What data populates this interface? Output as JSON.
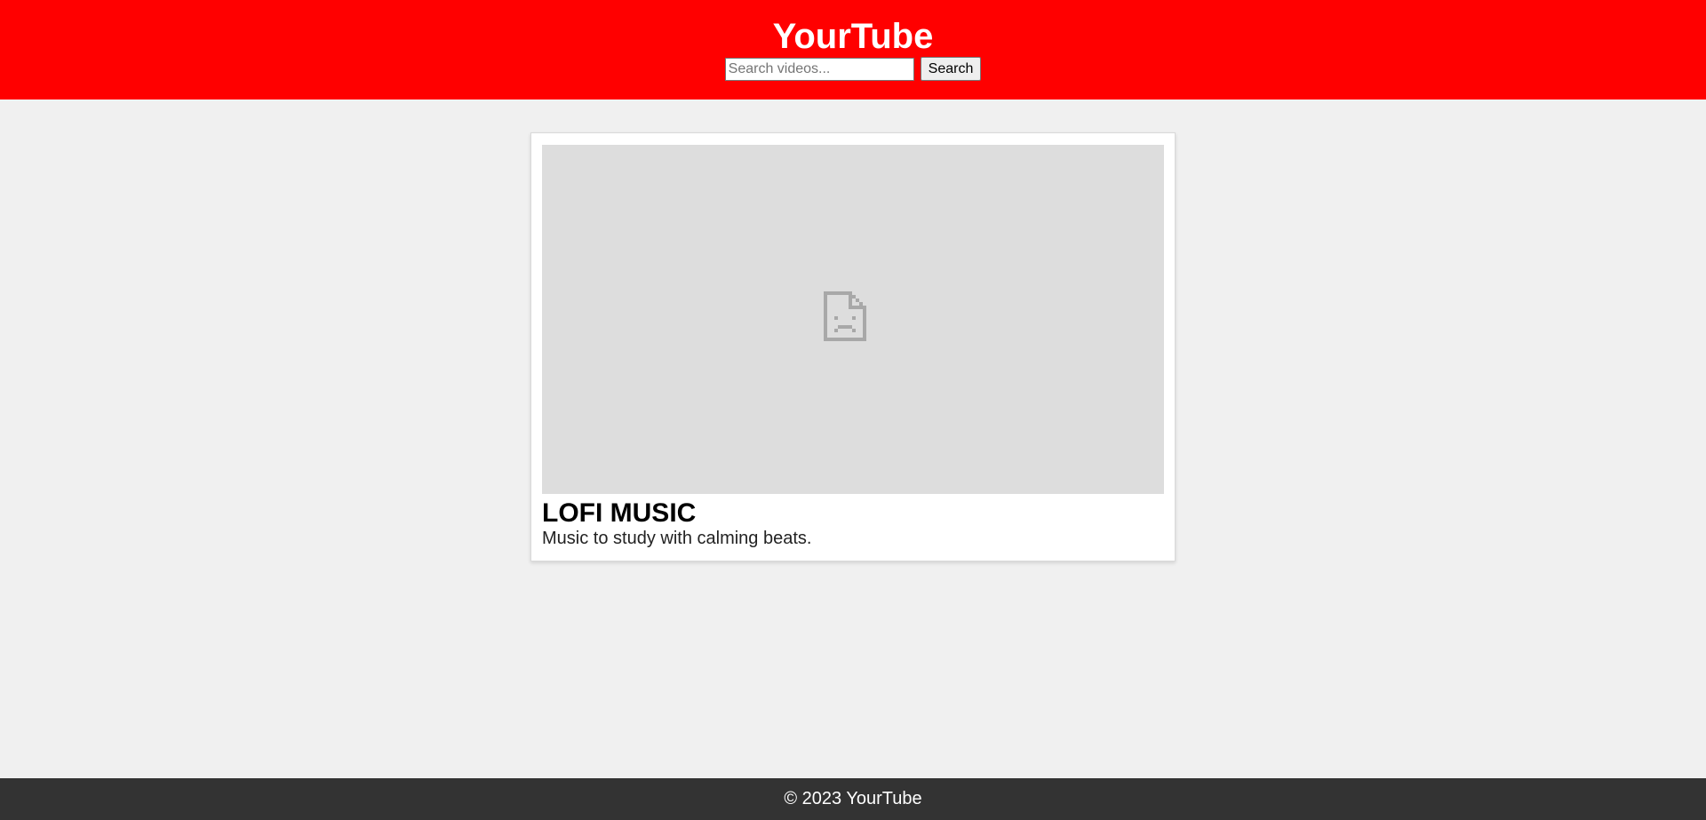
{
  "header": {
    "title": "YourTube",
    "search_placeholder": "Search videos...",
    "search_value": "",
    "search_button_label": "Search"
  },
  "video": {
    "title": "LOFI MUSIC",
    "description": "Music to study with calming beats.",
    "player_icon": "broken-document-icon"
  },
  "footer": {
    "text": "© 2023 YourTube"
  },
  "colors": {
    "brand": "#ff0000",
    "page_background": "#f0f0f0",
    "footer_background": "#333333",
    "player_placeholder": "#dddddd"
  }
}
